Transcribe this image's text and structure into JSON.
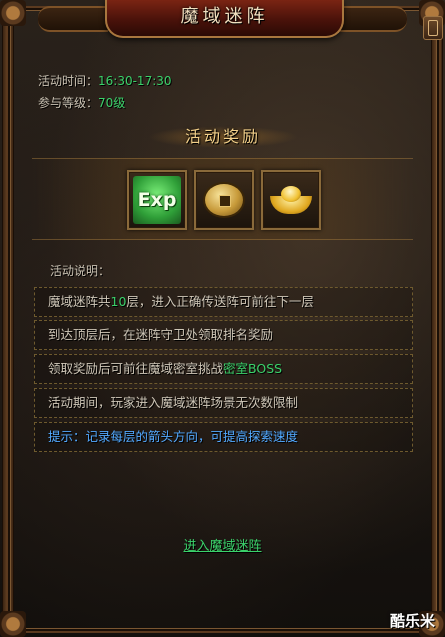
{
  "window": {
    "title": "魔域迷阵"
  },
  "info": {
    "time_label": "活动时间：",
    "time_value": "16:30-17:30",
    "level_label": "参与等级：",
    "level_value": "70级"
  },
  "rewards": {
    "title": "活动奖励",
    "items": [
      {
        "icon": "exp-icon",
        "label": "Exp"
      },
      {
        "icon": "coin-icon"
      },
      {
        "icon": "gold-ingot-icon"
      }
    ]
  },
  "description": {
    "title": "活动说明：",
    "lines": [
      {
        "pre": "魔域迷阵共",
        "highlight": "10",
        "post": "层，进入正确传送阵可前往下一层"
      },
      {
        "text": "到达顶层后，在迷阵守卫处领取排名奖励"
      },
      {
        "pre": "领取奖励后可前往魔域密室挑战",
        "highlight": "密室BOSS",
        "post": ""
      },
      {
        "text": "活动期间，玩家进入魔域迷阵场景无次数限制"
      },
      {
        "tip": "提示：记录每层的箭头方向，可提高探索速度"
      }
    ]
  },
  "action": {
    "enter_label": "进入魔域迷阵"
  },
  "watermark": "酷乐米",
  "colors": {
    "highlight_green": "#3bd16a",
    "tip_blue": "#52a9ff",
    "title_gold": "#f3d08a"
  }
}
